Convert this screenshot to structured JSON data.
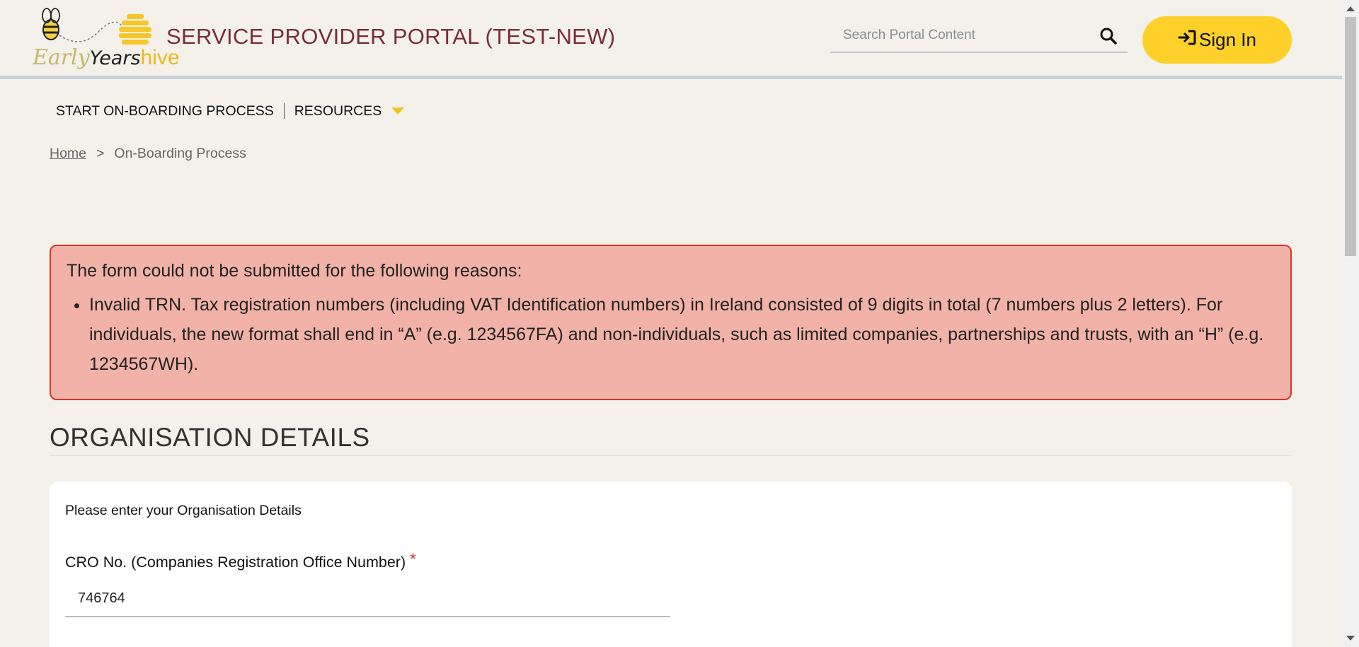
{
  "header": {
    "logo": {
      "word1": "Early",
      "word2": "Years",
      "word3": "hive"
    },
    "title": "SERVICE PROVIDER PORTAL (TEST-NEW)",
    "search_placeholder": "Search Portal Content",
    "search_icon": "magnifier-icon",
    "signin_label": "Sign In",
    "signin_icon": "sign-in-arrow-icon"
  },
  "nav": {
    "items": [
      {
        "label": "START ON-BOARDING PROCESS"
      },
      {
        "label": "RESOURCES"
      }
    ]
  },
  "breadcrumb": {
    "home": "Home",
    "separator": ">",
    "current": "On-Boarding Process"
  },
  "alert": {
    "heading": "The form could not be submitted for the following reasons:",
    "items": [
      "Invalid TRN. Tax registration numbers (including VAT Identification numbers) in Ireland consisted of 9 digits in total (7 numbers plus 2 letters). For individuals, the new format shall end in “A” (e.g. 1234567FA) and non-individuals, such as limited companies, partnerships and trusts, with an “H” (e.g. 1234567WH)."
    ]
  },
  "section": {
    "title": "ORGANISATION DETAILS"
  },
  "form": {
    "intro": "Please enter your Organisation Details",
    "cro_label": "CRO No. (Companies Registration Office Number)",
    "required_marker": "*",
    "cro_value": "746764"
  },
  "colors": {
    "brand_title": "#7a2e36",
    "accent_yellow": "#fdd02a",
    "alert_bg": "#f2b2a8",
    "alert_border": "#d9342b",
    "page_bg": "#f3f1ea"
  }
}
